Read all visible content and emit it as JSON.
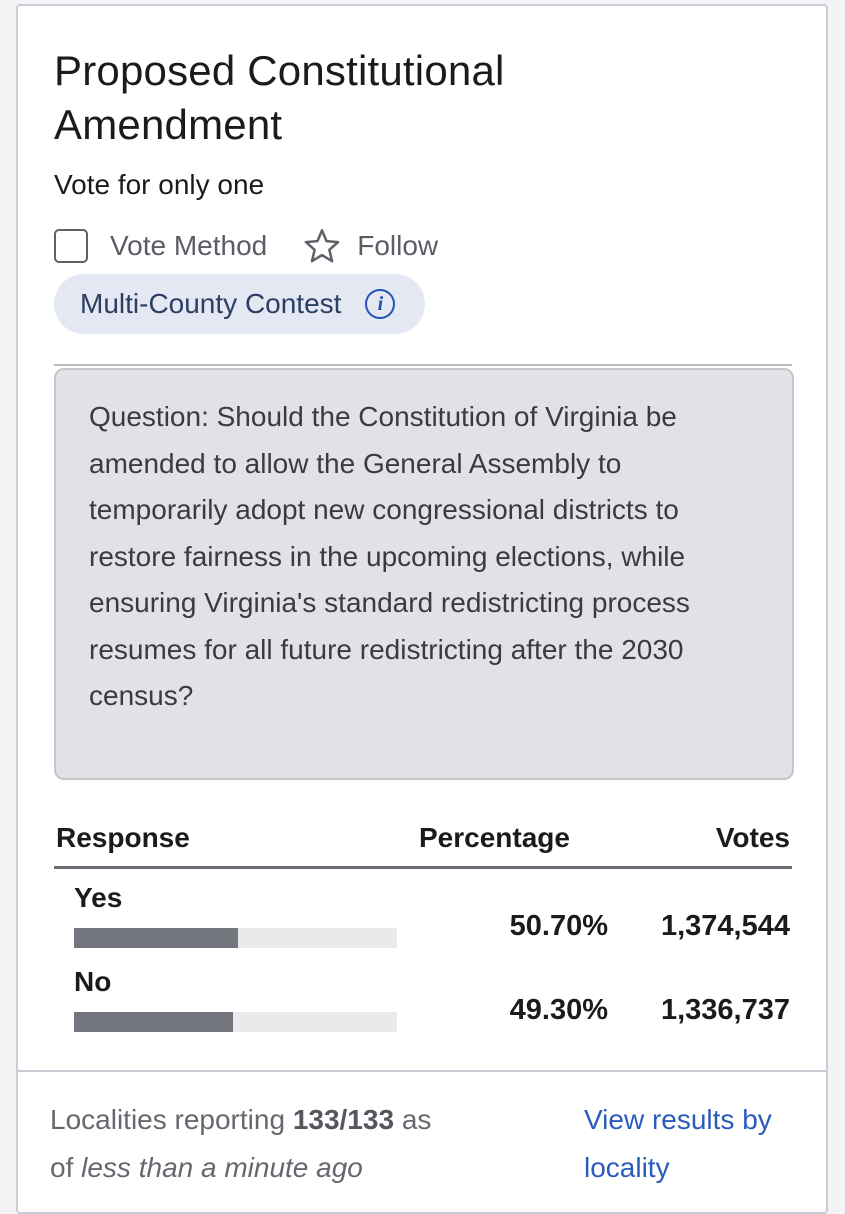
{
  "contest": {
    "title": "Proposed Constitutional Amendment",
    "vote_instruction": "Vote for only one",
    "vote_method_label": "Vote Method",
    "follow_label": "Follow",
    "tag_label": "Multi-County Contest",
    "question": "Question: Should the Constitution of Virginia be amended to allow the General Assembly to temporarily adopt new congressional districts to restore fairness in the upcoming elections, while ensuring Virginia's standard redistricting process resumes for all future redistricting after the 2030 census?"
  },
  "table": {
    "headers": {
      "response": "Response",
      "percentage": "Percentage",
      "votes": "Votes"
    },
    "rows": [
      {
        "response": "Yes",
        "percentage": "50.70%",
        "votes": "1,374,544",
        "share": 0.507
      },
      {
        "response": "No",
        "percentage": "49.30%",
        "votes": "1,336,737",
        "share": 0.493
      }
    ]
  },
  "footer": {
    "reporting_prefix": "Localities reporting",
    "reporting_count": "133/133",
    "reporting_as": "as",
    "reporting_of": "of",
    "reporting_time": "less than a minute ago",
    "link_text": "View results by locality"
  },
  "icons": {
    "checkbox": "checkbox-icon",
    "follow": "star-icon",
    "info": "info-icon"
  },
  "colors": {
    "accent": "#2a5bbd",
    "bar_fill": "#74767d",
    "tag_background": "#e3e8f3"
  }
}
